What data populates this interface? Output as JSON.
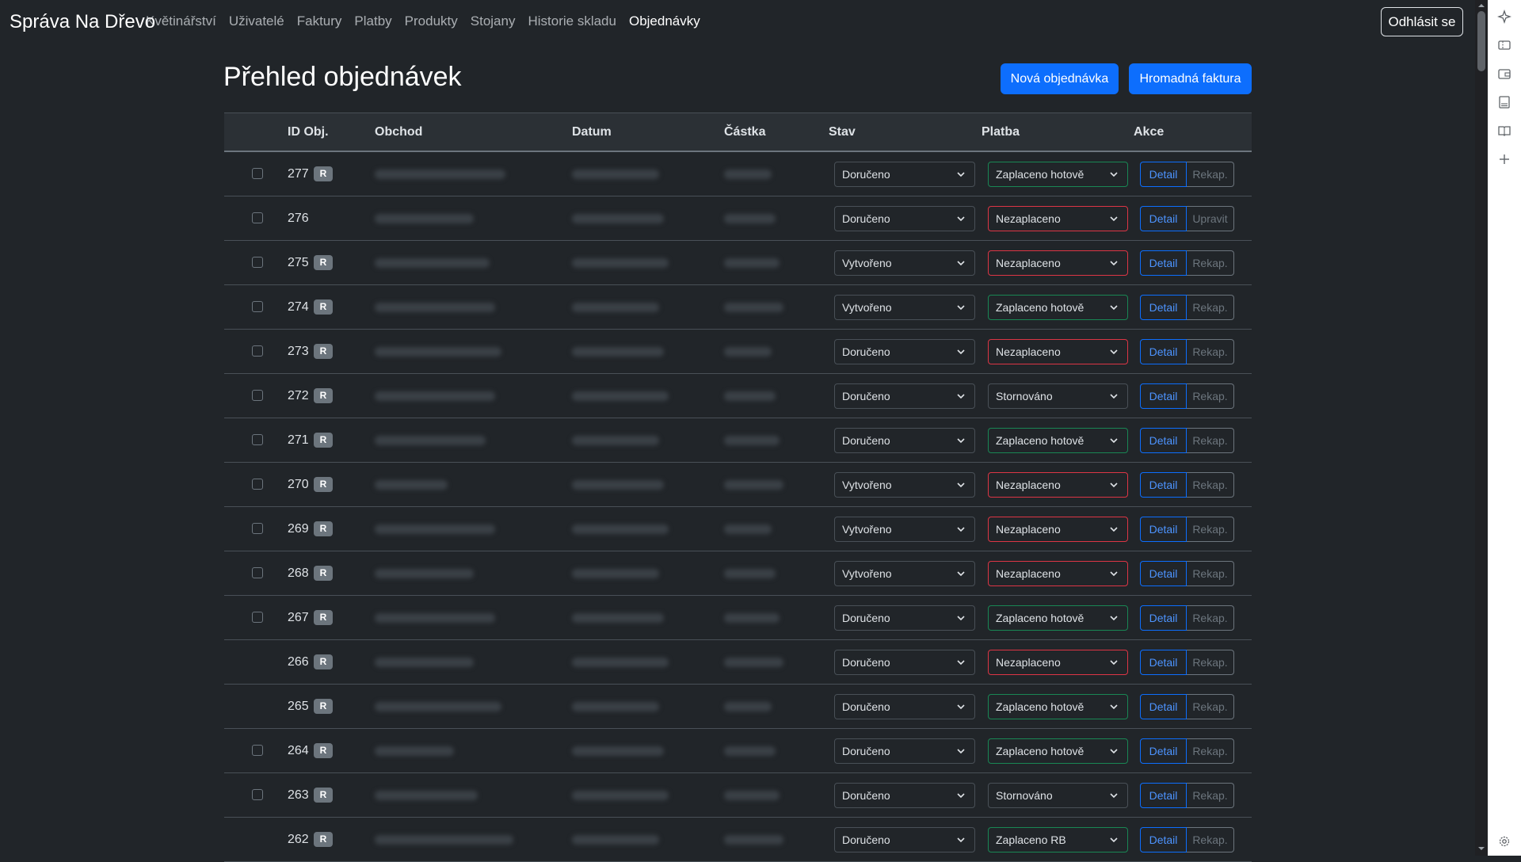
{
  "app": {
    "brand": "Správa Na Dřevo",
    "nav": [
      "Květinářství",
      "Uživatelé",
      "Faktury",
      "Platby",
      "Produkty",
      "Stojany",
      "Historie skladu",
      "Objednávky"
    ],
    "active_nav": "Objednávky",
    "logout": "Odhlásit se"
  },
  "page": {
    "title": "Přehled objednávek",
    "new_order": "Nová objednávka",
    "bulk_invoice": "Hromadná faktura"
  },
  "table": {
    "headers": [
      "ID Obj.",
      "Obchod",
      "Datum",
      "Částka",
      "Stav",
      "Platba",
      "Akce"
    ],
    "rows": [
      {
        "id": "277",
        "badge": "R",
        "state": "Doručeno",
        "payment": "Zaplaceno hotově",
        "pay_status": "paid",
        "checkbox": true,
        "secondary": "Rekap."
      },
      {
        "id": "276",
        "badge": "",
        "state": "Doručeno",
        "payment": "Nezaplaceno",
        "pay_status": "unpaid",
        "checkbox": true,
        "secondary": "Upravit"
      },
      {
        "id": "275",
        "badge": "R",
        "state": "Vytvořeno",
        "payment": "Nezaplaceno",
        "pay_status": "unpaid",
        "checkbox": true,
        "secondary": "Rekap."
      },
      {
        "id": "274",
        "badge": "R",
        "state": "Vytvořeno",
        "payment": "Zaplaceno hotově",
        "pay_status": "paid",
        "checkbox": true,
        "secondary": "Rekap."
      },
      {
        "id": "273",
        "badge": "R",
        "state": "Doručeno",
        "payment": "Nezaplaceno",
        "pay_status": "unpaid",
        "checkbox": true,
        "secondary": "Rekap."
      },
      {
        "id": "272",
        "badge": "R",
        "state": "Doručeno",
        "payment": "Stornováno",
        "pay_status": "neutral",
        "checkbox": true,
        "secondary": "Rekap."
      },
      {
        "id": "271",
        "badge": "R",
        "state": "Doručeno",
        "payment": "Zaplaceno hotově",
        "pay_status": "paid",
        "checkbox": true,
        "secondary": "Rekap."
      },
      {
        "id": "270",
        "badge": "R",
        "state": "Vytvořeno",
        "payment": "Nezaplaceno",
        "pay_status": "unpaid",
        "checkbox": true,
        "secondary": "Rekap."
      },
      {
        "id": "269",
        "badge": "R",
        "state": "Vytvořeno",
        "payment": "Nezaplaceno",
        "pay_status": "unpaid",
        "checkbox": true,
        "secondary": "Rekap."
      },
      {
        "id": "268",
        "badge": "R",
        "state": "Vytvořeno",
        "payment": "Nezaplaceno",
        "pay_status": "unpaid",
        "checkbox": true,
        "secondary": "Rekap."
      },
      {
        "id": "267",
        "badge": "R",
        "state": "Doručeno",
        "payment": "Zaplaceno hotově",
        "pay_status": "paid",
        "checkbox": true,
        "secondary": "Rekap."
      },
      {
        "id": "266",
        "badge": "R",
        "state": "Doručeno",
        "payment": "Nezaplaceno",
        "pay_status": "unpaid",
        "checkbox": false,
        "secondary": "Rekap."
      },
      {
        "id": "265",
        "badge": "R",
        "state": "Doručeno",
        "payment": "Zaplaceno hotově",
        "pay_status": "paid",
        "checkbox": false,
        "secondary": "Rekap."
      },
      {
        "id": "264",
        "badge": "R",
        "state": "Doručeno",
        "payment": "Zaplaceno hotově",
        "pay_status": "paid",
        "checkbox": true,
        "secondary": "Rekap."
      },
      {
        "id": "263",
        "badge": "R",
        "state": "Doručeno",
        "payment": "Stornováno",
        "pay_status": "neutral",
        "checkbox": true,
        "secondary": "Rekap."
      },
      {
        "id": "262",
        "badge": "R",
        "state": "Doručeno",
        "payment": "Zaplaceno RB",
        "pay_status": "paid",
        "checkbox": false,
        "secondary": "Rekap."
      }
    ],
    "detail_label": "Detail"
  },
  "colors": {
    "background": "#212529",
    "primary": "#0d6efd",
    "danger": "#dc3545",
    "success": "#198754"
  }
}
